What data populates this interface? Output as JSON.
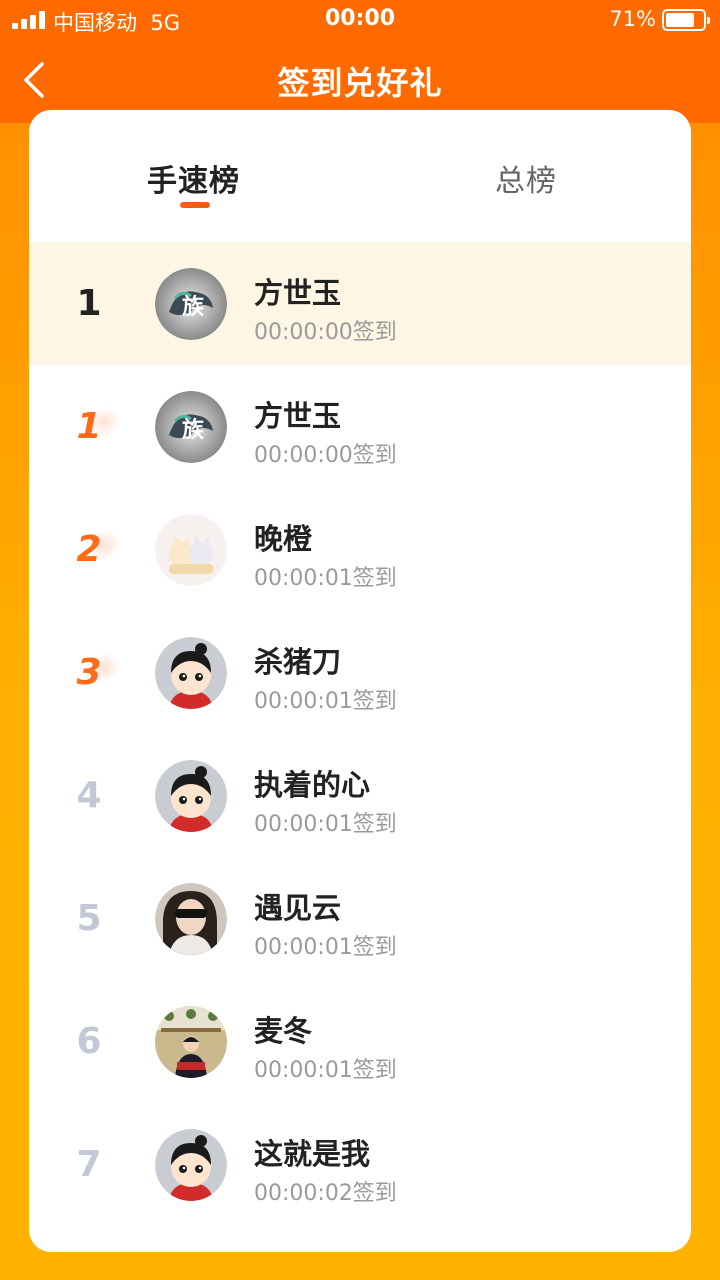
{
  "status_bar": {
    "carrier": "中国移动",
    "network": "5G",
    "time": "00:00",
    "battery": "71%",
    "battery_level": 0.71
  },
  "nav": {
    "back_icon": "chevron-left-icon",
    "title": "签到兑好礼"
  },
  "tabs": [
    {
      "label": "手速榜",
      "active": true
    },
    {
      "label": "总榜",
      "active": false
    }
  ],
  "my_entry": {
    "rank": "1",
    "name": "方世玉",
    "time": "00:00:00签到",
    "avatar": "dragon-avatar"
  },
  "ranking": [
    {
      "rank": "1",
      "name": "方世玉",
      "time": "00:00:00签到",
      "avatar": "dragon-avatar"
    },
    {
      "rank": "2",
      "name": "晚橙",
      "time": "00:00:01签到",
      "avatar": "cartoon-cats-avatar"
    },
    {
      "rank": "3",
      "name": "杀猪刀",
      "time": "00:00:01签到",
      "avatar": "cartoon-girl-avatar"
    },
    {
      "rank": "4",
      "name": "执着的心",
      "time": "00:00:01签到",
      "avatar": "cartoon-girl-avatar"
    },
    {
      "rank": "5",
      "name": "遇见云",
      "time": "00:00:01签到",
      "avatar": "photo-woman-avatar"
    },
    {
      "rank": "6",
      "name": "麦冬",
      "time": "00:00:01签到",
      "avatar": "photo-person-avatar"
    },
    {
      "rank": "7",
      "name": "这就是我",
      "time": "00:00:02签到",
      "avatar": "cartoon-girl-avatar"
    }
  ],
  "colors": {
    "header": "#ff6a00",
    "accent": "#ff5a14",
    "highlight_row": "#fdf6e4",
    "muted_rank": "#c3c8d6"
  }
}
